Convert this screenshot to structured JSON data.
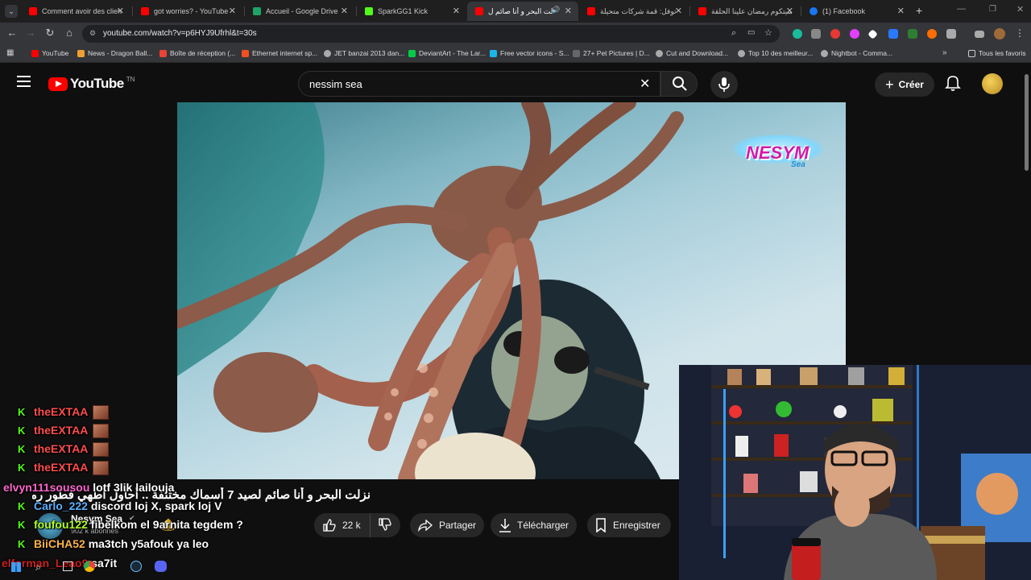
{
  "browser": {
    "tabs": [
      {
        "title": "Comment avoir des clien",
        "color": "#ff0000",
        "active": false
      },
      {
        "title": "got worries? - YouTube",
        "color": "#ff0000",
        "active": false
      },
      {
        "title": "Accueil - Google Drive",
        "color": "#1fa463",
        "active": false
      },
      {
        "title": "SparkGG1 Kick",
        "color": "#53fc18",
        "active": false
      },
      {
        "title": "نزلت البحر و أنا صائم ل",
        "color": "#ff0000",
        "active": true
      },
      {
        "title": "توفل: قمة شركات متحيلة",
        "color": "#ff0000",
        "active": false
      },
      {
        "title": "سيتكوم رمضان علينا الحلقة",
        "color": "#ff0000",
        "active": false
      },
      {
        "title": "(1) Facebook",
        "color": "#1877f2",
        "active": false
      }
    ],
    "url": "youtube.com/watch?v=p6HYJ9Ufrhl&t=30s",
    "bookmarks": [
      {
        "label": "YouTube",
        "color": "#ff0000"
      },
      {
        "label": "News - Dragon Ball...",
        "color": "#f0a030"
      },
      {
        "label": "Boîte de réception (...",
        "color": "#ea4335"
      },
      {
        "label": "Ethernet internet sp...",
        "color": "#f25022"
      },
      {
        "label": "JET banzai 2013 dan...",
        "color": "#aaaaaa"
      },
      {
        "label": "DeviantArt - The Lar...",
        "color": "#05cc47"
      },
      {
        "label": "Free vector icons - S...",
        "color": "#1ab7ea"
      },
      {
        "label": "27+ Pet Pictures | D...",
        "color": "#333333"
      },
      {
        "label": "Cut and Download...",
        "color": "#aaaaaa"
      },
      {
        "label": "Top 10 des meilleur...",
        "color": "#aaaaaa"
      },
      {
        "label": "Nightbot - Comma...",
        "color": "#aaaaaa"
      }
    ],
    "bookmarks_all": "Tous les favoris"
  },
  "youtube": {
    "logo_text": "YouTube",
    "logo_region": "TN",
    "search_query": "nessim sea",
    "create_label": "Créer",
    "video_watermark": "NESYM",
    "video_watermark_sub": "Sea",
    "video_title": "نزلت البحر و أنا صائم لصيد 7 أسماك مختلفة .. أحاول أطهي فطور رمضان!",
    "channel_name": "Nesym Sea",
    "subscribers": "902 k abonnés",
    "likes": "22 k",
    "share_label": "Partager",
    "download_label": "Télécharger",
    "save_label": "Enregistrer"
  },
  "chat": [
    {
      "user": "theEXTAA",
      "color": "#ff4d4d",
      "text": "",
      "badge": "K",
      "emote": true
    },
    {
      "user": "theEXTAA",
      "color": "#ff4d4d",
      "text": "",
      "badge": "K",
      "emote": true
    },
    {
      "user": "theEXTAA",
      "color": "#ff4d4d",
      "text": "",
      "badge": "K",
      "emote": true
    },
    {
      "user": "theEXTAA",
      "color": "#ff4d4d",
      "text": "",
      "badge": "K",
      "emote": true
    },
    {
      "user": "elvyn111sousou",
      "color": "#ff66cc",
      "text": "lotf 3lik lailouja",
      "badge": "",
      "emote": false
    },
    {
      "user": "Carlo_222",
      "color": "#5ab0ff",
      "text": "discord loj X, spark loj V",
      "badge": "K",
      "emote": false
    },
    {
      "user": "foufou122",
      "color": "#b0ff2a",
      "text": "fibelkom el 9arnita tegdem ?",
      "badge": "K",
      "emote": false
    },
    {
      "user": "BiiCHA52",
      "color": "#ffb347",
      "text": "ma3tch y5afouk ya leo",
      "badge": "K",
      "emote": false
    },
    {
      "user": "elforman_Leao9",
      "color": "#cc2020",
      "text": "sa7it",
      "badge": "",
      "emote": false
    }
  ]
}
